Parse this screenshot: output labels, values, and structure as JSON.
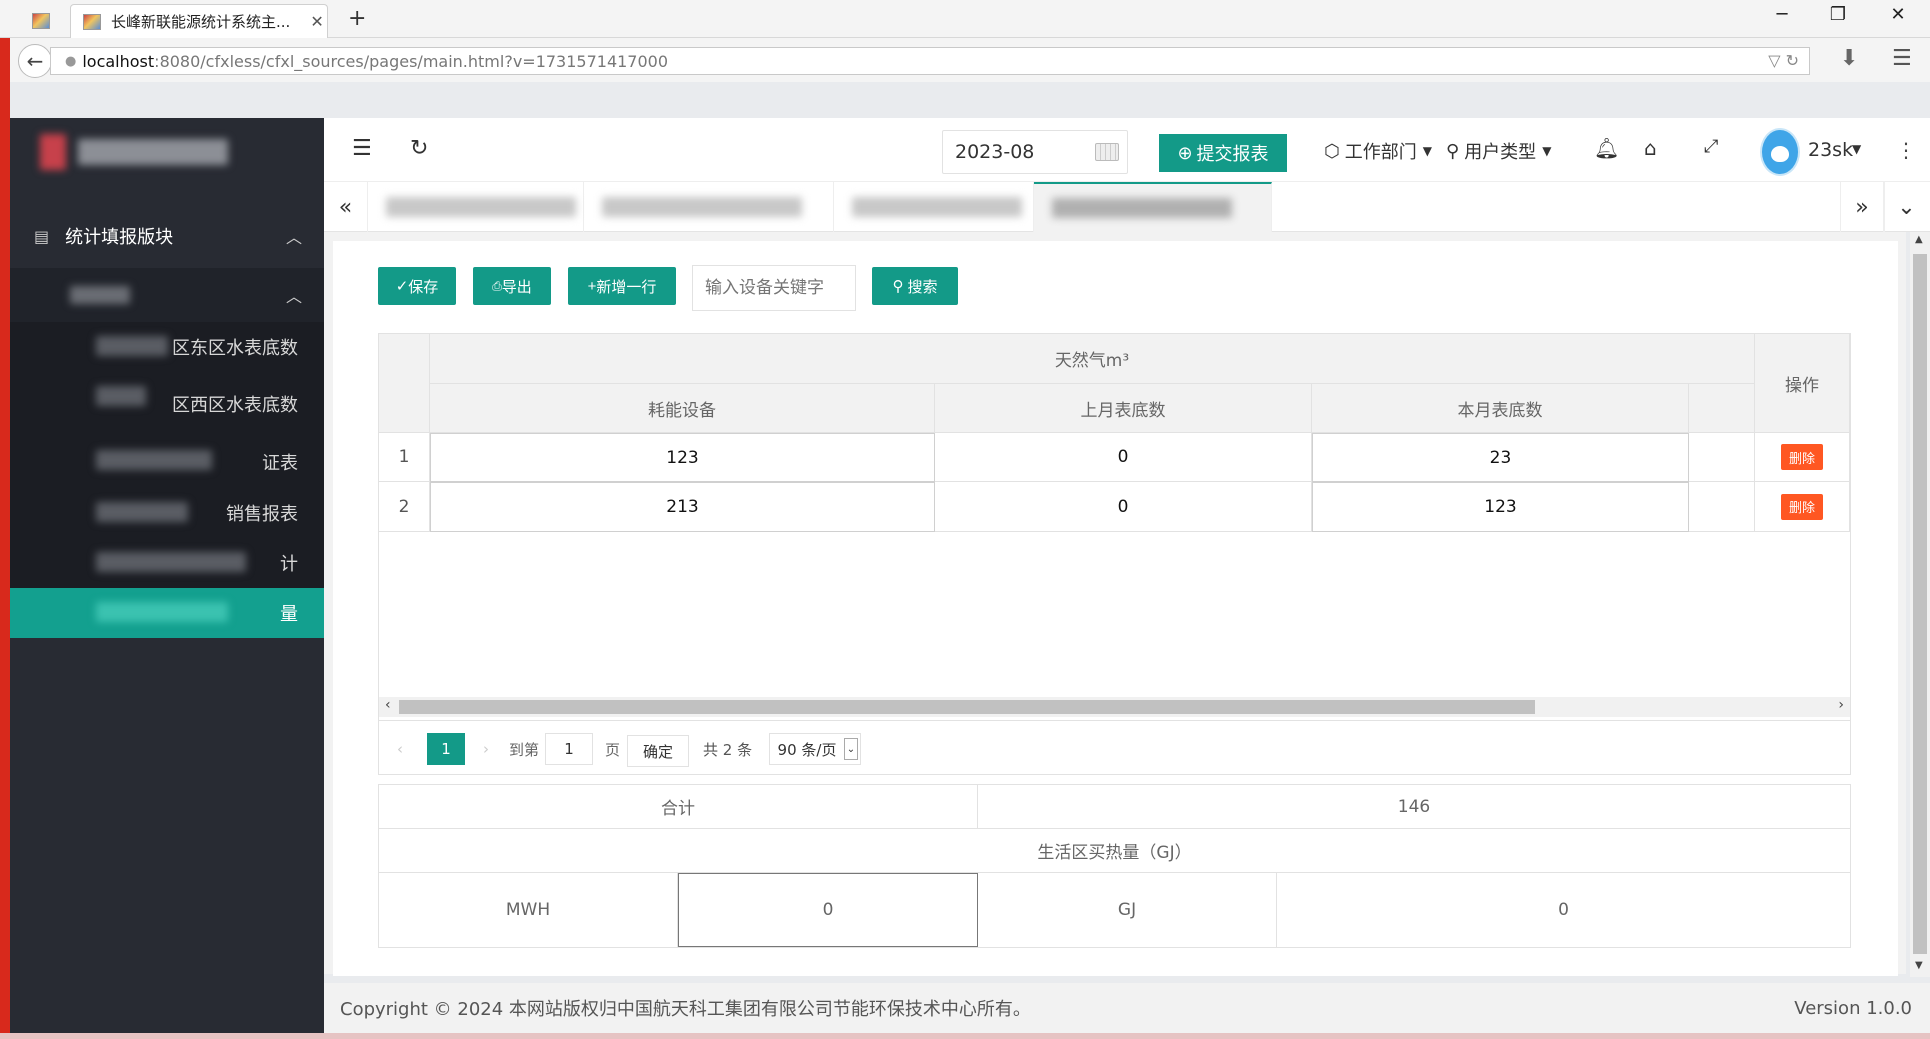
{
  "browser": {
    "tabs": [
      {
        "label": ""
      },
      {
        "label": "长峰新联能源统计系统主...",
        "close": "✕"
      }
    ],
    "new_tab": "+",
    "window_controls": {
      "minimize": "─",
      "restore": "❐",
      "close": "✕"
    },
    "url_host": "localhost",
    "url_rest": ":8080/cfxless/cfxl_sources/pages/main.html?v=1731571417000"
  },
  "sidebar": {
    "group_label": "统计填报版块",
    "items": [
      {
        "label": "区东区水表底数"
      },
      {
        "label": "区西区水表底数"
      },
      {
        "label": "证表"
      },
      {
        "label": "销售报表"
      },
      {
        "label": "计"
      },
      {
        "label": "量"
      }
    ],
    "active_index": 5
  },
  "header": {
    "date_value": "2023-08",
    "submit_label": "提交报表",
    "dept_label": "工作部门",
    "user_type_label": "用户类型",
    "username": "23sk"
  },
  "toolbar": {
    "save_label": "保存",
    "export_label": "导出",
    "add_row_label": "新增一行",
    "search_placeholder": "输入设备关键字",
    "search_label": "搜索"
  },
  "table": {
    "group_header": "天然气m³",
    "columns": [
      "耗能设备",
      "上月表底数",
      "本月表底数"
    ],
    "action_header": "操作",
    "rows": [
      {
        "index": "1",
        "device": "123",
        "last_month": "0",
        "this_month": "23",
        "action": "删除"
      },
      {
        "index": "2",
        "device": "213",
        "last_month": "0",
        "this_month": "123",
        "action": "删除"
      }
    ]
  },
  "pager": {
    "current_page": "1",
    "goto_label": "到第",
    "goto_value": "1",
    "page_unit": "页",
    "confirm_label": "确定",
    "total_label": "共 2 条",
    "page_size": "90 条/页"
  },
  "summary": {
    "total_label": "合计",
    "total_value": "146",
    "section_title": "生活区买热量（GJ）",
    "mwh_label": "MWH",
    "mwh_value": "0",
    "gj_label": "GJ",
    "gj_value": "0"
  },
  "footer": {
    "copyright": "Copyright © 2024 本网站版权归中国航天科工集团有限公司节能环保技术中心所有。",
    "version": "Version 1.0.0"
  }
}
